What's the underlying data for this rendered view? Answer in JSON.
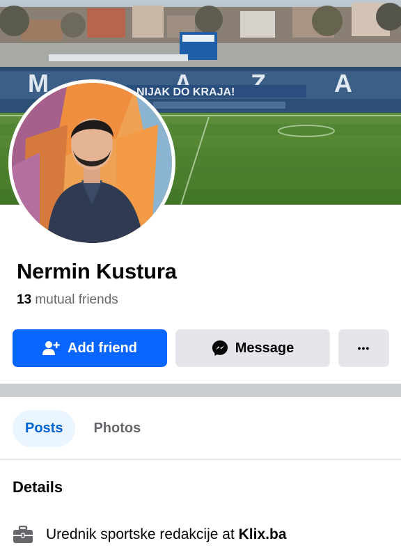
{
  "profile": {
    "name": "Nermin Kustura",
    "mutual_count": "13",
    "mutual_label": "mutual friends"
  },
  "cover": {
    "banner_text": "NIJAK DO KRAJA!",
    "stand_letters": [
      "M",
      "A",
      "Z",
      "A"
    ]
  },
  "actions": {
    "add_friend_label": "Add friend",
    "message_label": "Message",
    "more_label": "•••"
  },
  "tabs": [
    {
      "label": "Posts",
      "active": true
    },
    {
      "label": "Photos",
      "active": false
    }
  ],
  "details": {
    "title": "Details",
    "work_prefix": "Urednik sportske redakcije at",
    "work_place": "Klix.ba"
  },
  "colors": {
    "primary": "#0866ff",
    "secondary_bg": "#e4e6eb",
    "active_tab_bg": "#ebf5ff",
    "active_tab_text": "#0064d1",
    "muted_text": "#65676b"
  },
  "icons": [
    "person-add-icon",
    "messenger-icon",
    "more-icon",
    "briefcase-icon"
  ]
}
